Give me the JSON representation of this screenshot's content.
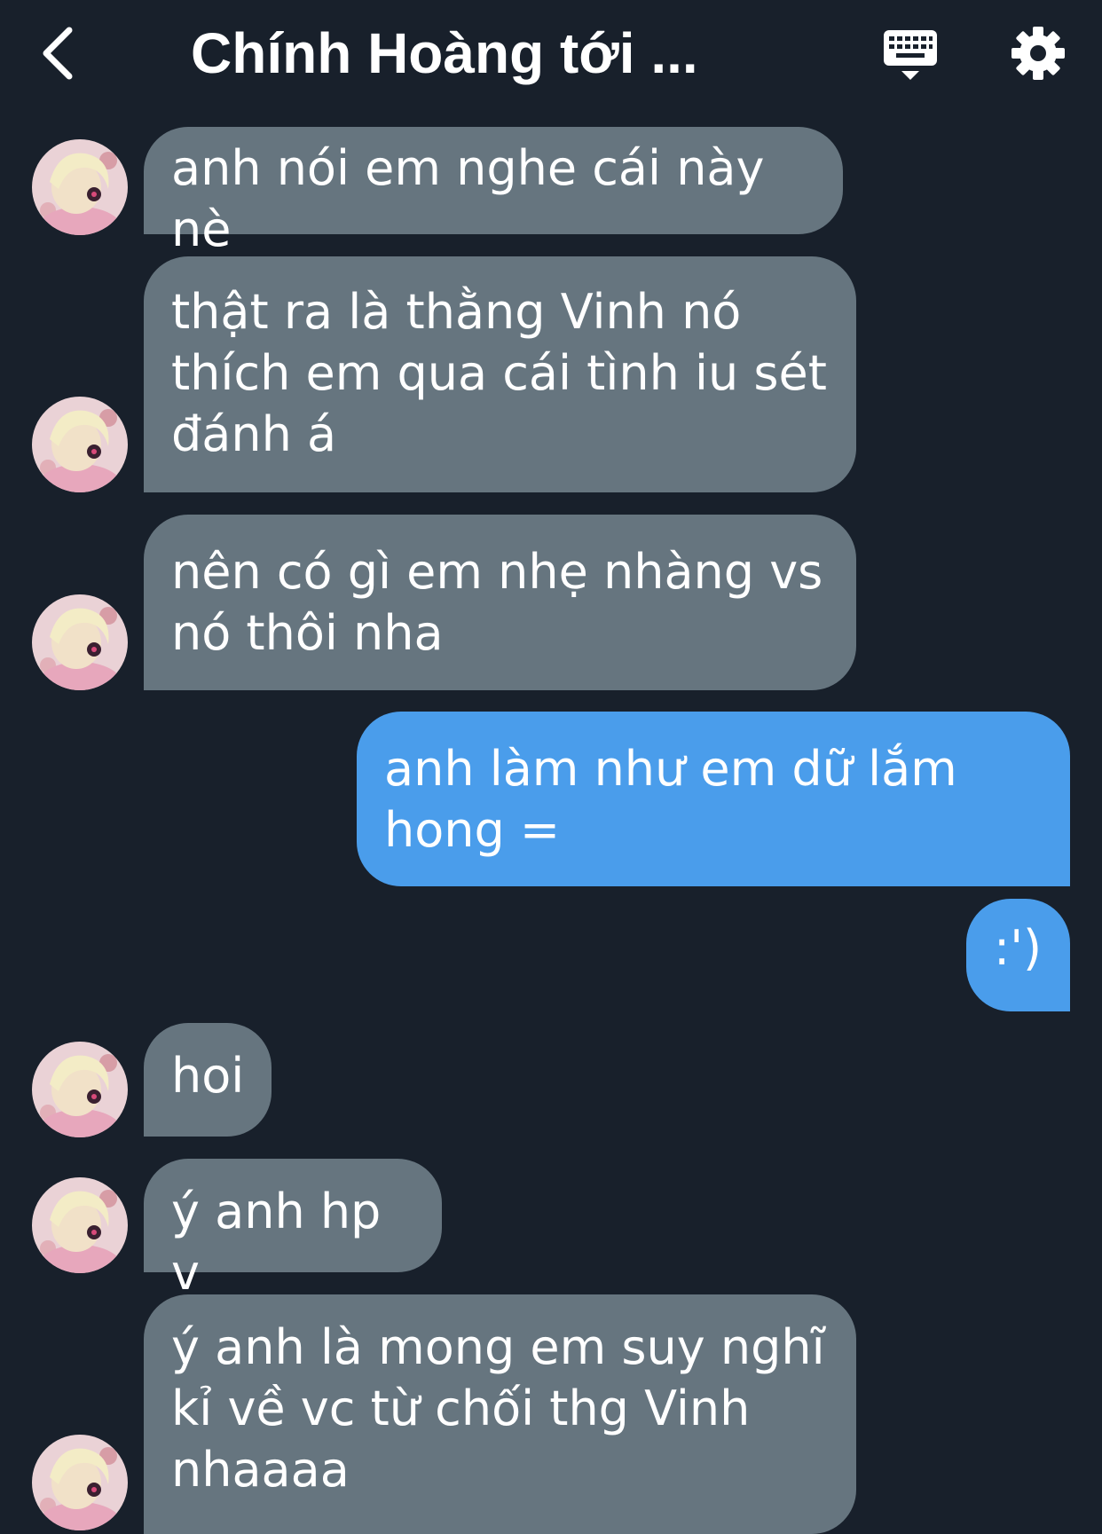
{
  "header": {
    "title": "Chính Hoàng tới ...",
    "back_icon": "chevron-left-icon",
    "keyboard_icon": "keyboard-icon",
    "settings_icon": "gear-icon"
  },
  "colors": {
    "background": "#18202b",
    "incoming_bubble": "#66757f",
    "outgoing_bubble": "#4a9deb",
    "text": "#ffffff"
  },
  "messages": [
    {
      "direction": "incoming",
      "text": "anh nói em nghe cái này nè"
    },
    {
      "direction": "incoming",
      "text": "thật ra là thằng Vinh nó\nthích em qua cái tình iu sét\nđánh á"
    },
    {
      "direction": "incoming",
      "text": "nên có gì em nhẹ nhàng vs\nnó thôi nha"
    },
    {
      "direction": "outgoing",
      "text": "anh làm như em dữ lắm\nhong ="
    },
    {
      "direction": "outgoing",
      "text": ":')"
    },
    {
      "direction": "incoming",
      "text": "hoi"
    },
    {
      "direction": "incoming",
      "text": "ý anh hp v"
    },
    {
      "direction": "incoming",
      "text": "ý anh là mong em suy nghĩ\nkỉ về vc từ chối thg Vinh\nnhaaaa"
    }
  ]
}
